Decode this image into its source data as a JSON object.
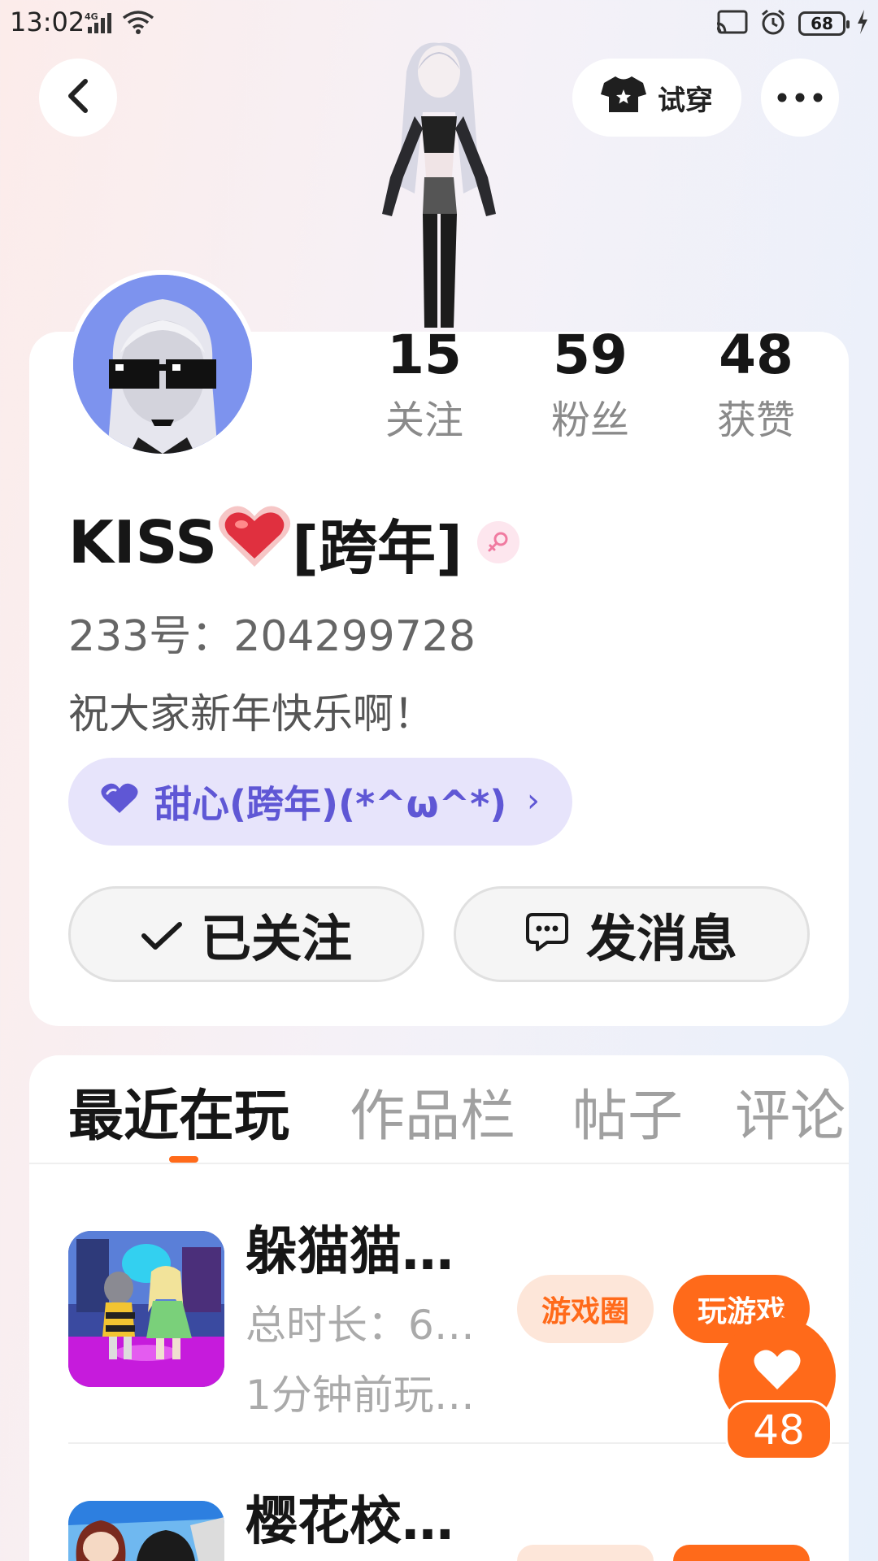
{
  "status_bar": {
    "time": "13:02",
    "network": "4G",
    "battery": "68"
  },
  "header": {
    "tryon_label": "试穿"
  },
  "stats": [
    {
      "value": "15",
      "label": "关注"
    },
    {
      "value": "59",
      "label": "粉丝"
    },
    {
      "value": "48",
      "label": "获赞"
    }
  ],
  "profile": {
    "nickname_pre": "KISS",
    "nickname_post": "[跨年]",
    "uid": "233号：204299728",
    "bio": "祝大家新年快乐啊！",
    "guild": "甜心(跨年)(*^ω^*)"
  },
  "actions": {
    "follow_label": "已关注",
    "message_label": "发消息"
  },
  "tabs": [
    "最近在玩",
    "作品栏",
    "帖子",
    "评论"
  ],
  "games": [
    {
      "name": "躲猫猫…",
      "duration": "总时长：6…",
      "last_played": "1分钟前玩…",
      "circle_label": "游戏圈",
      "play_label": "玩游戏"
    },
    {
      "name": "樱花校…"
    }
  ],
  "like_fab": {
    "count": "48"
  },
  "colors": {
    "accent": "#ff6a1a",
    "guild": "#5f57d5",
    "guild_bg": "#e7e4fb",
    "gender": "#f07aa0"
  }
}
